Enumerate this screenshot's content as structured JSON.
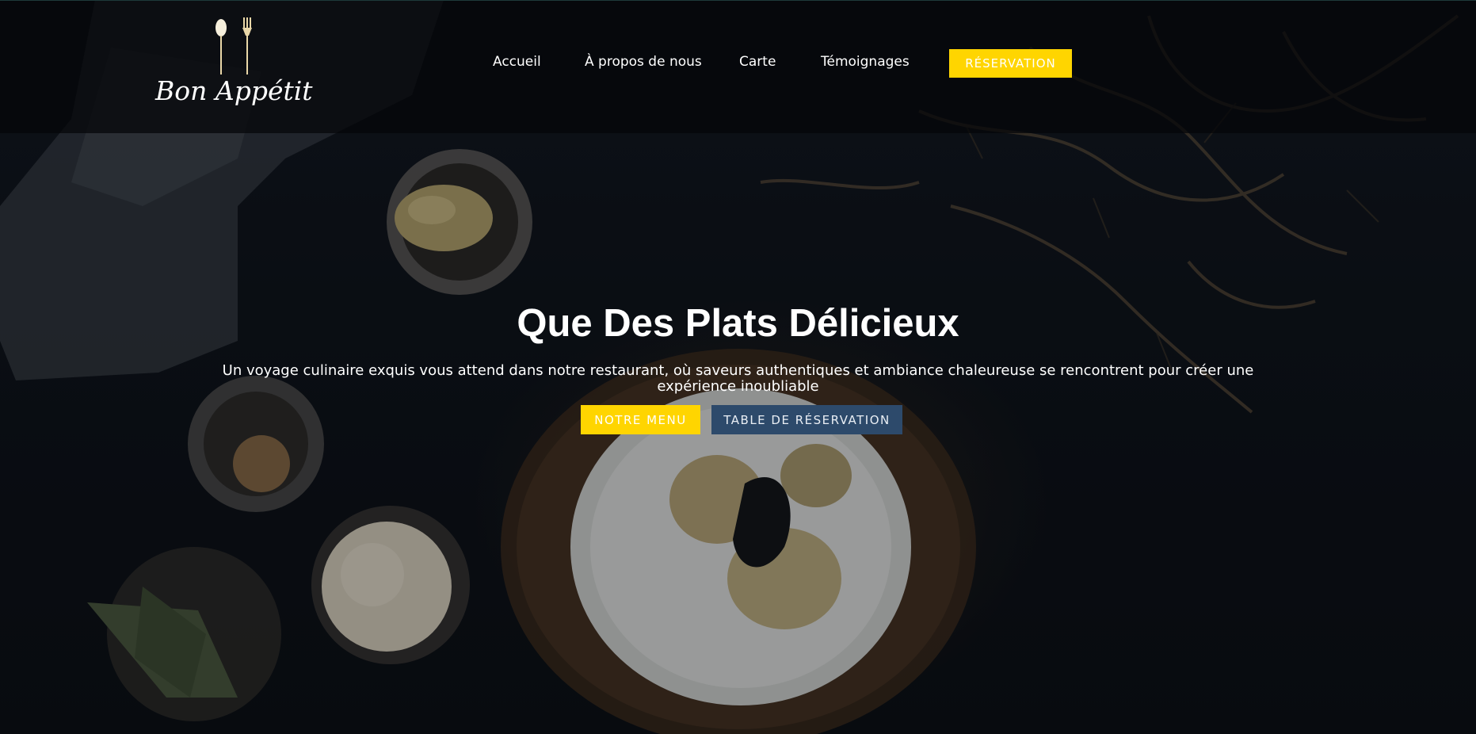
{
  "brand": {
    "name": "Bon Appétit",
    "logo_icon": "spoon-fork-icon",
    "accent_color": "#ffd500",
    "secondary_color": "#2d4a6b"
  },
  "nav": {
    "items": [
      {
        "label": "Accueil"
      },
      {
        "label": "À propos de nous"
      },
      {
        "label": "Carte"
      },
      {
        "label": "Témoignages"
      }
    ],
    "cta_label": "RÉSERVATION"
  },
  "hero": {
    "title": "Que Des Plats Délicieux",
    "subtitle": "Un voyage culinaire exquis vous attend dans notre restaurant, où saveurs authentiques et ambiance chaleureuse se rencontrent pour créer une expérience inoubliable",
    "buttons": {
      "menu_label": "NOTRE MENU",
      "reservation_label": "TABLE DE RÉSERVATION"
    }
  }
}
